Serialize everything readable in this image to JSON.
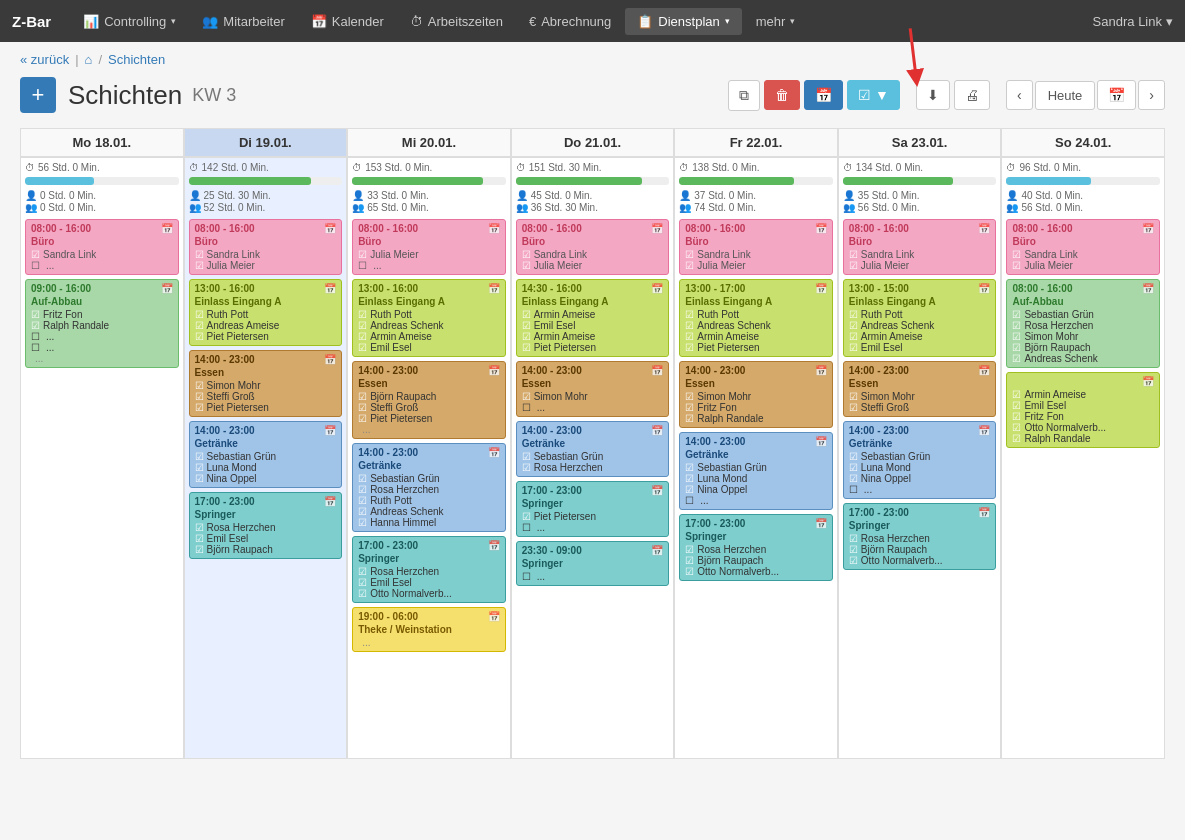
{
  "navbar": {
    "brand": "Z-Bar",
    "items": [
      {
        "label": "Controlling",
        "icon": "chart-icon",
        "dropdown": true,
        "active": false
      },
      {
        "label": "Mitarbeiter",
        "icon": "people-icon",
        "dropdown": false,
        "active": false
      },
      {
        "label": "Kalender",
        "icon": "calendar-icon",
        "dropdown": false,
        "active": false
      },
      {
        "label": "Arbeitszeiten",
        "icon": "clock-icon",
        "dropdown": false,
        "active": false
      },
      {
        "label": "Abrechnung",
        "icon": "euro-icon",
        "dropdown": false,
        "active": false
      },
      {
        "label": "Dienstplan",
        "icon": "calendar2-icon",
        "dropdown": true,
        "active": true
      },
      {
        "label": "mehr",
        "icon": "",
        "dropdown": true,
        "active": false
      }
    ],
    "user": "Sandra Link"
  },
  "breadcrumb": {
    "back": "« zurück",
    "home": "⌂",
    "current": "Schichten"
  },
  "pageHeader": {
    "title": "Schichten",
    "kw": "KW 3"
  },
  "toolbar": {
    "copy_label": "⧉",
    "delete_label": "🗑",
    "calendar_label": "📅",
    "filter_label": "▼",
    "download_label": "↓",
    "print_label": "🖨",
    "prev_label": "‹",
    "today_label": "Heute",
    "cal_label": "📅",
    "next_label": "›"
  },
  "days": [
    {
      "label": "Mo 18.01.",
      "today": false,
      "total_hours": "56 Std. 0 Min.",
      "progress": 45,
      "progress_color": "pb-teal",
      "stat1": "0 Std. 0 Min.",
      "stat2": "0 Std. 0 Min.",
      "shifts": [
        {
          "style": "shift-pink",
          "time": "08:00 - 16:00",
          "title": "Büro",
          "persons": [
            "Sandra Link"
          ],
          "empty": 1
        },
        {
          "style": "shift-green",
          "time": "09:00 - 16:00",
          "title": "Auf-Abbau",
          "persons": [
            "Fritz Fon",
            "Ralph Randale"
          ],
          "empty": 2,
          "ellipsis": true
        }
      ]
    },
    {
      "label": "Di 19.01.",
      "today": true,
      "total_hours": "142 Std. 0 Min.",
      "progress": 80,
      "progress_color": "pb-green",
      "stat1": "25 Std. 30 Min.",
      "stat2": "52 Std. 0 Min.",
      "shifts": [
        {
          "style": "shift-pink",
          "time": "08:00 - 16:00",
          "title": "Büro",
          "persons": [
            "Sandra Link",
            "Julia Meier"
          ],
          "empty": 0
        },
        {
          "style": "shift-yellowgreen",
          "time": "13:00 - 16:00",
          "title": "Einlass Eingang A",
          "persons": [
            "Ruth Pott",
            "Andreas Ameise",
            "Piet Pietersen"
          ],
          "empty": 0
        },
        {
          "style": "shift-brown",
          "time": "14:00 - 23:00",
          "title": "Essen",
          "persons": [
            "Simon Mohr",
            "Steffi Groß",
            "Piet Pietersen"
          ],
          "empty": 0
        },
        {
          "style": "shift-blue",
          "time": "14:00 - 23:00",
          "title": "Getränke",
          "persons": [
            "Sebastian Grün",
            "Luna Mond",
            "Nina Oppel"
          ],
          "empty": 0
        },
        {
          "style": "shift-teal",
          "time": "17:00 - 23:00",
          "title": "Springer",
          "persons": [
            "Rosa Herzchen",
            "Emil Esel",
            "Björn Raupach"
          ],
          "empty": 0
        }
      ]
    },
    {
      "label": "Mi 20.01.",
      "today": false,
      "total_hours": "153 Std. 0 Min.",
      "progress": 85,
      "progress_color": "pb-green",
      "stat1": "33 Std. 0 Min.",
      "stat2": "65 Std. 0 Min.",
      "shifts": [
        {
          "style": "shift-pink",
          "time": "08:00 - 16:00",
          "title": "Büro",
          "persons": [
            "Julia Meier"
          ],
          "empty": 1
        },
        {
          "style": "shift-yellowgreen",
          "time": "13:00 - 16:00",
          "title": "Einlass Eingang A",
          "persons": [
            "Ruth Pott",
            "Andreas Schenk",
            "Armin Ameise",
            "Emil Esel"
          ],
          "empty": 0
        },
        {
          "style": "shift-brown",
          "time": "14:00 - 23:00",
          "title": "Essen",
          "persons": [
            "Björn Raupach",
            "Steffi Groß",
            "Piet Pietersen"
          ],
          "empty": 0,
          "ellipsis": true
        },
        {
          "style": "shift-blue",
          "time": "14:00 - 23:00",
          "title": "Getränke",
          "persons": [
            "Sebastian Grün",
            "Rosa Herzchen",
            "Ruth Pott",
            "Andreas Schenk",
            "Hanna Himmel"
          ],
          "empty": 0
        },
        {
          "style": "shift-teal",
          "time": "17:00 - 23:00",
          "title": "Springer",
          "persons": [
            "Rosa Herzchen",
            "Emil Esel",
            "Otto Normalverb..."
          ],
          "empty": 0
        },
        {
          "style": "shift-yellow",
          "time": "19:00 - 06:00",
          "title": "Theke / Weinstation",
          "persons": [],
          "empty": 0,
          "ellipsis": true
        }
      ]
    },
    {
      "label": "Do 21.01.",
      "today": false,
      "total_hours": "151 Std. 30 Min.",
      "progress": 82,
      "progress_color": "pb-green",
      "stat1": "45 Std. 0 Min.",
      "stat2": "36 Std. 30 Min.",
      "shifts": [
        {
          "style": "shift-pink",
          "time": "08:00 - 16:00",
          "title": "Büro",
          "persons": [
            "Sandra Link",
            "Julia Meier"
          ],
          "empty": 0
        },
        {
          "style": "shift-yellowgreen",
          "time": "14:30 - 16:00",
          "title": "Einlass Eingang A",
          "persons": [
            "Armin Ameise",
            "Emil Esel",
            "Armin Ameise",
            "Piet Pietersen"
          ],
          "empty": 0
        },
        {
          "style": "shift-brown",
          "time": "14:00 - 23:00",
          "title": "Essen",
          "persons": [
            "Simon Mohr"
          ],
          "empty": 1
        },
        {
          "style": "shift-blue",
          "time": "14:00 - 23:00",
          "title": "Getränke",
          "persons": [
            "Sebastian Grün",
            "Rosa Herzchen"
          ],
          "empty": 0
        },
        {
          "style": "shift-teal",
          "time": "17:00 - 23:00",
          "title": "Springer",
          "persons": [
            "Piet Pietersen"
          ],
          "empty": 1
        },
        {
          "style": "shift-teal",
          "time": "23:30 - 09:00",
          "title": "Springer",
          "persons": [],
          "empty": 1
        }
      ]
    },
    {
      "label": "Fr 22.01.",
      "today": false,
      "total_hours": "138 Std. 0 Min.",
      "progress": 75,
      "progress_color": "pb-green",
      "stat1": "37 Std. 0 Min.",
      "stat2": "74 Std. 0 Min.",
      "shifts": [
        {
          "style": "shift-pink",
          "time": "08:00 - 16:00",
          "title": "Büro",
          "persons": [
            "Sandra Link",
            "Julia Meier"
          ],
          "empty": 0
        },
        {
          "style": "shift-yellowgreen",
          "time": "13:00 - 17:00",
          "title": "Einlass Eingang A",
          "persons": [
            "Ruth Pott",
            "Andreas Schenk",
            "Armin Ameise",
            "Piet Pietersen"
          ],
          "empty": 0
        },
        {
          "style": "shift-brown",
          "time": "14:00 - 23:00",
          "title": "Essen",
          "persons": [
            "Simon Mohr",
            "Fritz Fon",
            "Ralph Randale"
          ],
          "empty": 0
        },
        {
          "style": "shift-blue",
          "time": "14:00 - 23:00",
          "title": "Getränke",
          "persons": [
            "Sebastian Grün",
            "Luna Mond",
            "Nina Oppel"
          ],
          "empty": 1
        },
        {
          "style": "shift-teal",
          "time": "17:00 - 23:00",
          "title": "Springer",
          "persons": [
            "Rosa Herzchen",
            "Björn Raupach",
            "Otto Normalverb..."
          ],
          "empty": 0
        }
      ]
    },
    {
      "label": "Sa 23.01.",
      "today": false,
      "total_hours": "134 Std. 0 Min.",
      "progress": 72,
      "progress_color": "pb-green",
      "stat1": "35 Std. 0 Min.",
      "stat2": "56 Std. 0 Min.",
      "shifts": [
        {
          "style": "shift-pink",
          "time": "08:00 - 16:00",
          "title": "Büro",
          "persons": [
            "Sandra Link",
            "Julia Meier"
          ],
          "empty": 0
        },
        {
          "style": "shift-yellowgreen",
          "time": "13:00 - 15:00",
          "title": "Einlass Eingang A",
          "persons": [
            "Ruth Pott",
            "Andreas Schenk",
            "Armin Ameise",
            "Emil Esel"
          ],
          "empty": 0
        },
        {
          "style": "shift-brown",
          "time": "14:00 - 23:00",
          "title": "Essen",
          "persons": [
            "Simon Mohr",
            "Steffi Groß"
          ],
          "empty": 0
        },
        {
          "style": "shift-blue",
          "time": "14:00 - 23:00",
          "title": "Getränke",
          "persons": [
            "Sebastian Grün",
            "Luna Mond",
            "Nina Oppel"
          ],
          "empty": 1
        },
        {
          "style": "shift-teal",
          "time": "17:00 - 23:00",
          "title": "Springer",
          "persons": [
            "Rosa Herzchen",
            "Björn Raupach",
            "Otto Normalverb..."
          ],
          "empty": 0
        }
      ]
    },
    {
      "label": "So 24.01.",
      "today": false,
      "total_hours": "96 Std. 0 Min.",
      "progress": 55,
      "progress_color": "pb-teal",
      "stat1": "40 Std. 0 Min.",
      "stat2": "56 Std. 0 Min.",
      "shifts": [
        {
          "style": "shift-pink",
          "time": "08:00 - 16:00",
          "title": "Büro",
          "persons": [
            "Sandra Link",
            "Julia Meier"
          ],
          "empty": 0
        },
        {
          "style": "shift-green",
          "time": "08:00 - 16:00",
          "title": "Auf-Abbau",
          "persons": [
            "Sebastian Grün",
            "Rosa Herzchen",
            "Simon Mohr",
            "Björn Raupach",
            "Andreas Schenk"
          ],
          "empty": 0
        },
        {
          "style": "shift-yellowgreen",
          "time": "",
          "title": "",
          "persons": [
            "Armin Ameise",
            "Emil Esel",
            "Fritz Fon",
            "Otto Normalverb...",
            "Ralph Randale"
          ],
          "empty": 0
        }
      ]
    }
  ]
}
